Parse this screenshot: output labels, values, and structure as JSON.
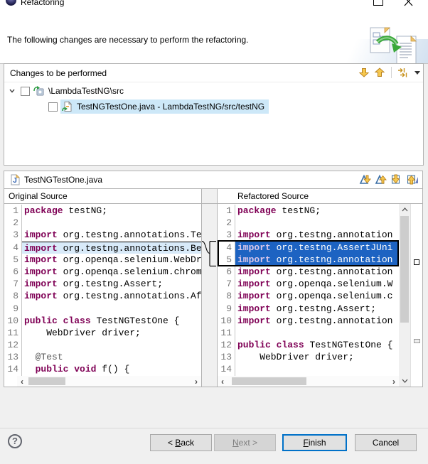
{
  "window": {
    "title": "Refactoring"
  },
  "header": {
    "message": "The following changes are necessary to perform the refactoring."
  },
  "changes_panel": {
    "title": "Changes to be performed",
    "toolbar_icons": [
      "move-down-icon",
      "move-up-icon",
      "filter-changes-icon",
      "dropdown-caret-icon"
    ],
    "tree": [
      {
        "label": "\\LambdaTestNG\\src",
        "checked": false,
        "expanded": true,
        "selected": false,
        "icon": "package-change-icon"
      },
      {
        "label": "TestNGTestOne.java - LambdaTestNG/src/testNG",
        "checked": false,
        "selected": true,
        "icon": "file-change-icon"
      }
    ]
  },
  "compare": {
    "file_name": "TestNGTestOne.java",
    "left_title": "Original Source",
    "right_title": "Refactored Source",
    "toolbar_icons": [
      "next-difference-icon",
      "previous-difference-icon",
      "next-change-icon",
      "previous-change-icon"
    ],
    "keywords": [
      "package",
      "import",
      "public",
      "class",
      "void"
    ],
    "left_lines": [
      "package testNG;",
      "",
      "import org.testng.annotations.Te",
      "import org.testng.annotations.Be",
      "import org.openqa.selenium.WebDr",
      "import org.openqa.selenium.chrom",
      "import org.testng.Assert;",
      "import org.testng.annotations.Af",
      "",
      "public class TestNGTestOne {",
      "    WebDriver driver;",
      "",
      "  @Test",
      "  public void f() {"
    ],
    "right_lines": [
      "package testNG;",
      "",
      "import org.testng.annotation",
      "import org.testng.AssertJUni",
      "import org.testng.annotation",
      "import org.testng.annotation",
      "import org.openqa.selenium.W",
      "import org.openqa.selenium.c",
      "import org.testng.Assert;",
      "import org.testng.annotation",
      "",
      "public class TestNGTestOne {",
      "    WebDriver driver;",
      ""
    ],
    "left_changed_lines": [
      4
    ],
    "right_selected_lines": [
      4,
      5
    ]
  },
  "footer": {
    "back_label": "< Back",
    "back_mnemonic": "B",
    "next_label": "Next >",
    "next_mnemonic": "N",
    "finish_label": "Finish",
    "finish_mnemonic": "F",
    "cancel_label": "Cancel",
    "help_label": "?"
  },
  "colors": {
    "keyword": "#7f0055",
    "selection_blue": "#1d63c2",
    "changed_line_bg": "#d8eaf9",
    "tree_selection_bg": "#cde8f8",
    "accent_gold": "#f6c84f",
    "accent_gold_outline": "#b9821e",
    "nav_blue": "#3a6ea5",
    "line_number": "#787878"
  }
}
